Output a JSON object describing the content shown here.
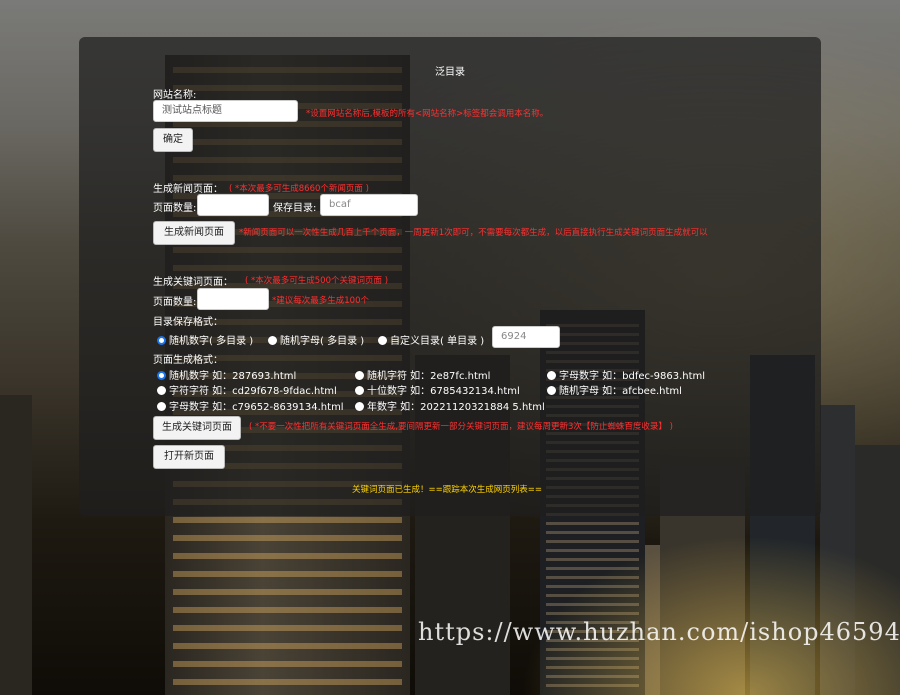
{
  "page_title": "泛目录",
  "site_name": {
    "label": "网站名称:",
    "value": "测试站点标题",
    "hint": "*设置网站名称后,模板的所有<网站名称>标签都会调用本名称。",
    "confirm_label": "确定"
  },
  "news": {
    "heading": "生成新闻页面：",
    "heading_note": "( *本次最多可生成8660个新闻页面 )",
    "count_label": "页面数量:",
    "count_value": "",
    "dir_label": "保存目录:",
    "dir_placeholder": "bcaf",
    "button_label": "生成新闻页面",
    "hint": "*新闻页面可以一次性生成几百上千个页面，一周更新1次即可，不需要每次都生成，以后直接执行生成关键词页面生成就可以"
  },
  "keyword": {
    "heading": "生成关键词页面：",
    "heading_note": "( *本次最多可生成500个关键词页面 )",
    "count_label": "页面数量:",
    "count_value": "",
    "count_hint": "*建议每次最多生成100个",
    "dir_format_label": "目录保存格式：",
    "dir_options": [
      {
        "label": "随机数字( 多目录 )",
        "selected": true
      },
      {
        "label": "随机字母( 多目录 )",
        "selected": false
      },
      {
        "label": "自定义目录( 单目录 )",
        "selected": false
      }
    ],
    "custom_dir_placeholder": "6924",
    "page_format_label": "页面生成格式：",
    "page_options": [
      {
        "label": "随机数字 如：287693.html",
        "selected": true
      },
      {
        "label": "随机字符 如：2e87fc.html",
        "selected": false
      },
      {
        "label": "字母数字 如：bdfec-9863.html",
        "selected": false
      },
      {
        "label": "字符字符 如：cd29f678-9fdac.html",
        "selected": false
      },
      {
        "label": "十位数字 如：6785432134.html",
        "selected": false
      },
      {
        "label": "随机字母 如：afcbee.html",
        "selected": false
      },
      {
        "label": "字母数字 如：c79652-8639134.html",
        "selected": false
      },
      {
        "label": "年数字 如：20221120321884 5.html",
        "selected": false
      }
    ],
    "button_label": "生成关键词页面",
    "hint": "( *不要一次性把所有关键词页面全生成,要间隔更新一部分关键词页面，建议每周更新3次【防止蜘蛛百度收录】 )",
    "open_label": "打开新页面"
  },
  "status_message": "关键词页面已生成！==跟踪本次生成网页列表==",
  "watermark": "https://www.huzhan.com/ishop46594"
}
